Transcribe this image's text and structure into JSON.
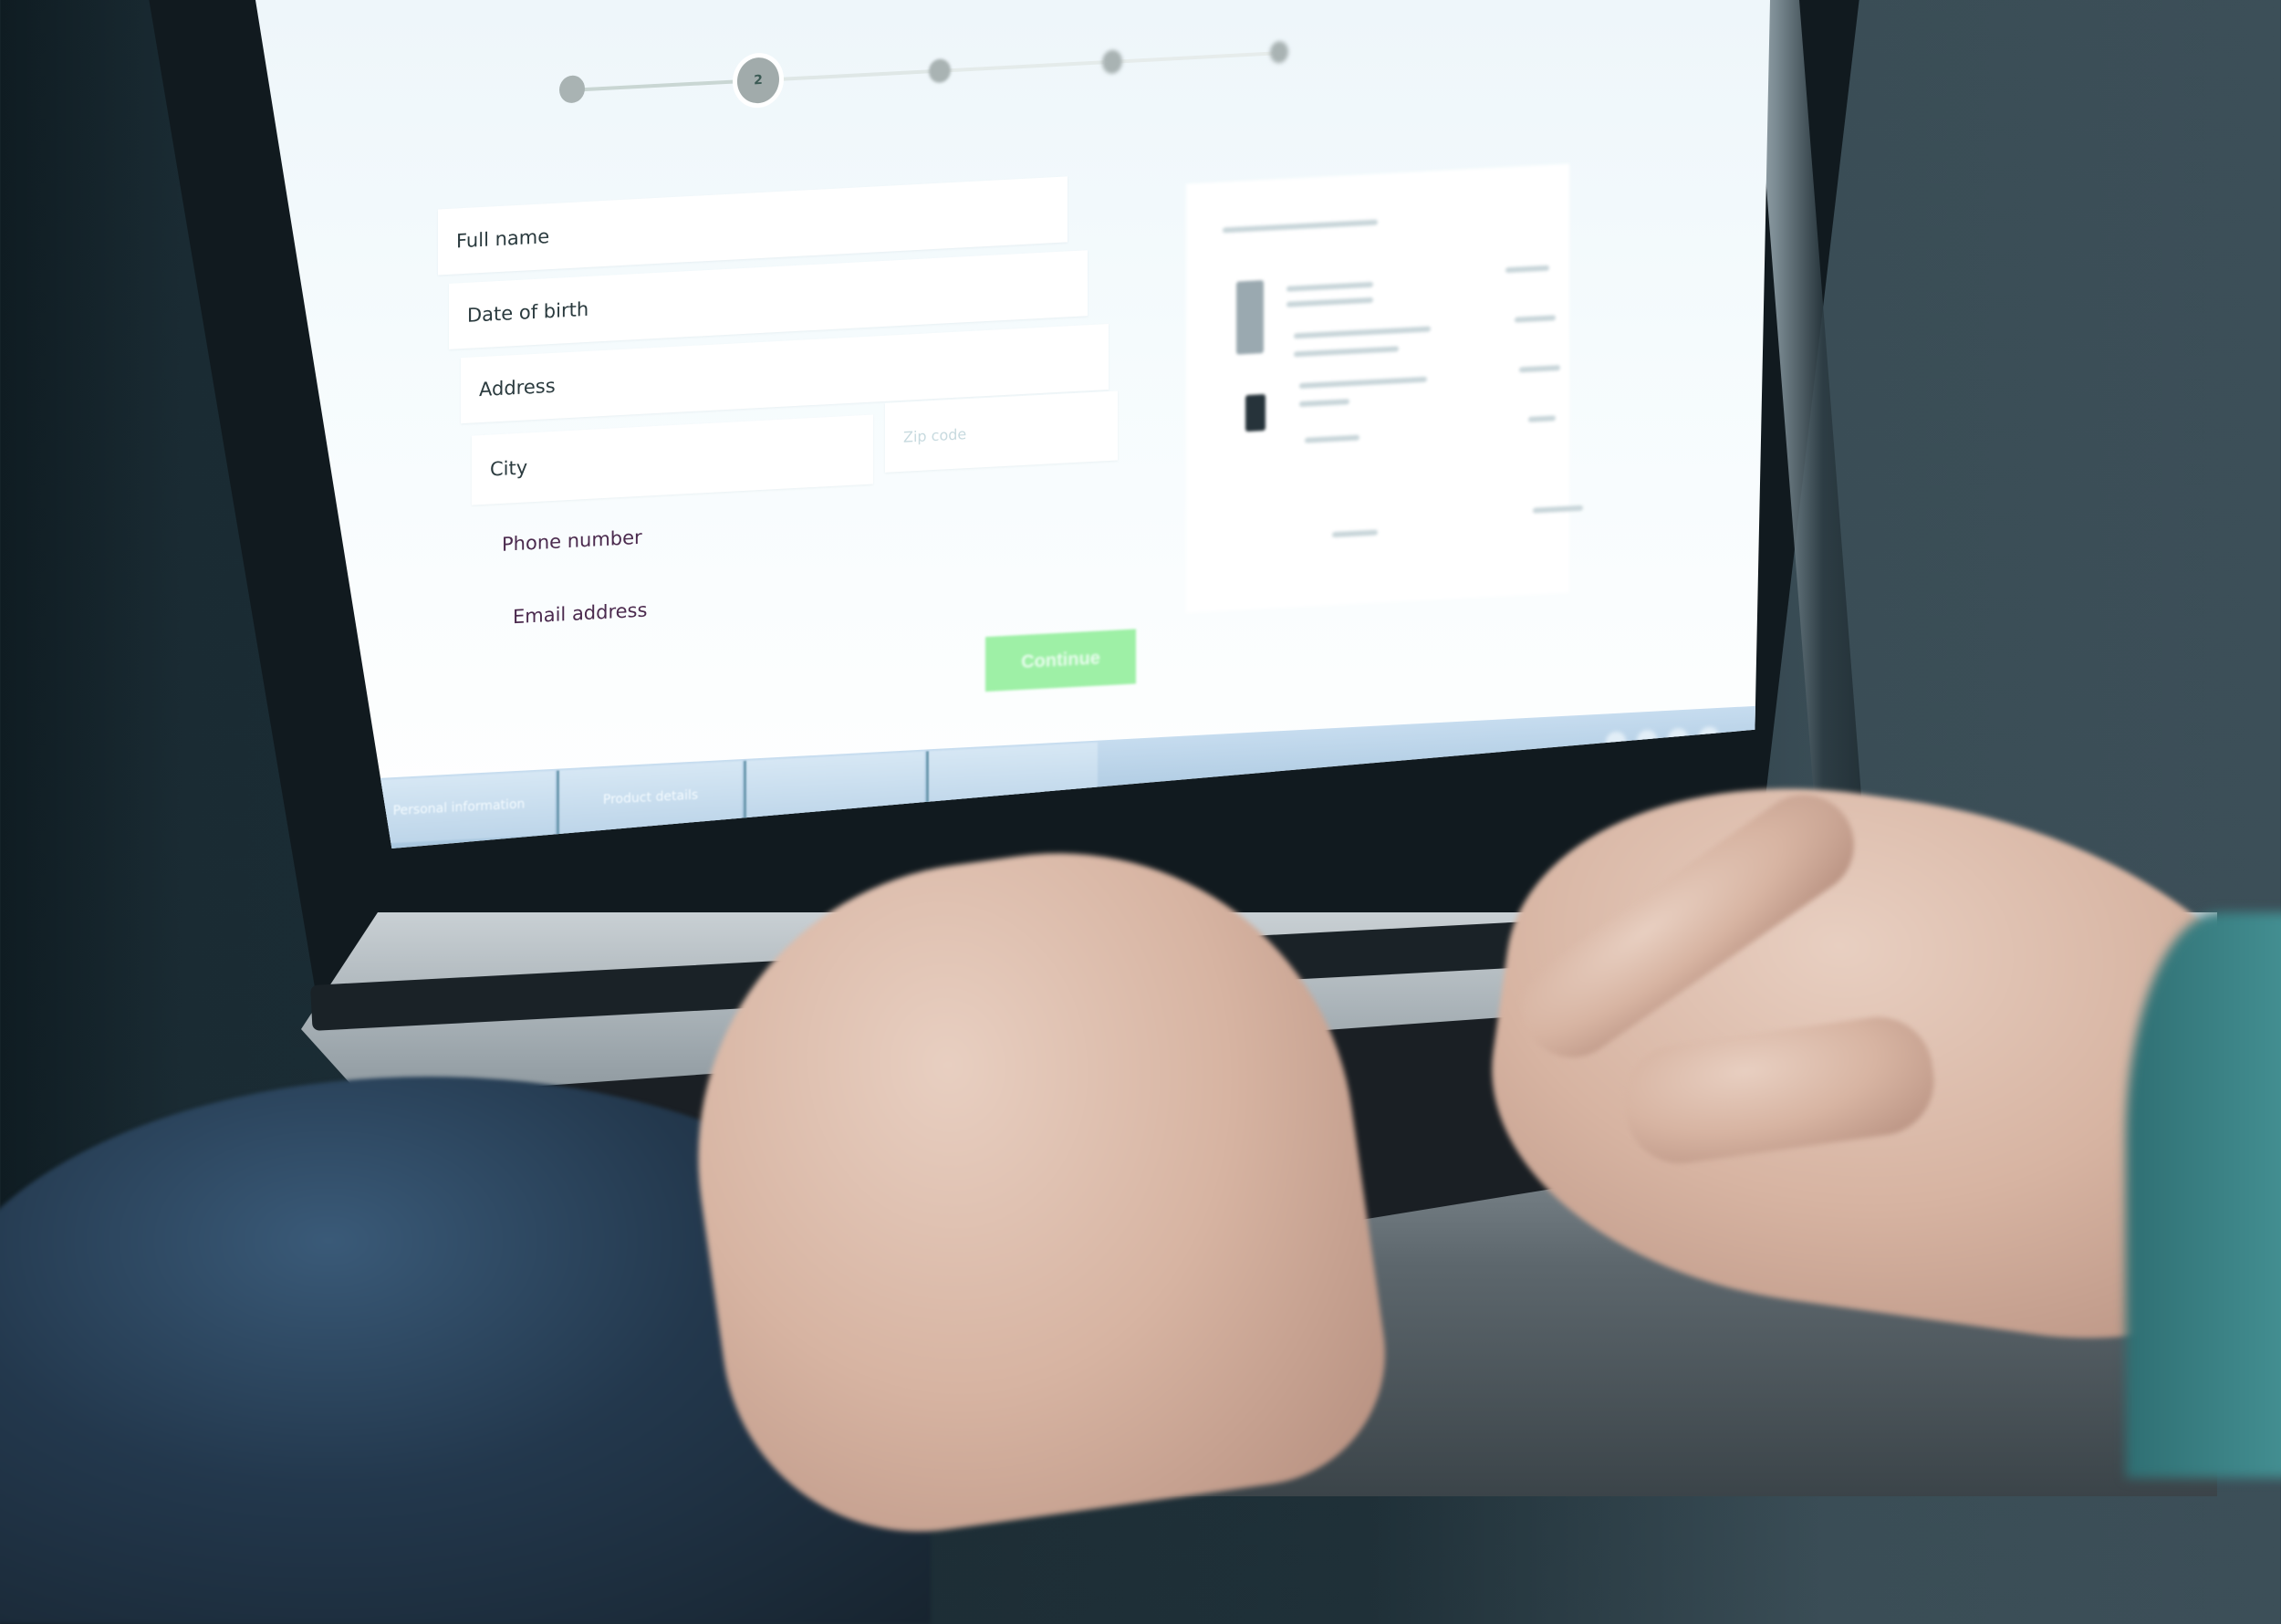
{
  "scene": {
    "description": "Person typing on a laptop displaying an online checkout/registration form",
    "colors": {
      "background": "#1f3038",
      "screen": "#f5fbfd",
      "continue_button": "#9ef0a6",
      "taskbar": "#bdd5e9",
      "stepper_dot": "#a9b3b3"
    }
  },
  "stepper": {
    "total_steps": 5,
    "active_step": 2,
    "steps": [
      {
        "label": ""
      },
      {
        "label": "2"
      },
      {
        "label": ""
      },
      {
        "label": ""
      },
      {
        "label": ""
      }
    ]
  },
  "form": {
    "fields": [
      {
        "label": "Full name"
      },
      {
        "label": "Date of birth"
      },
      {
        "label": "Address"
      },
      {
        "label": "City"
      },
      {
        "label": "Zip code"
      },
      {
        "label": "Phone number"
      },
      {
        "label": "Email address"
      }
    ],
    "continue_label": "Continue"
  },
  "summary_card": {
    "title": "",
    "items_count": 4,
    "note": "Contents illegible (out of focus)"
  },
  "taskbar": {
    "home_icon": "home-icon",
    "tabs": [
      {
        "label": "Personal information"
      },
      {
        "label": "Product details"
      },
      {
        "label": ""
      },
      {
        "label": ""
      }
    ]
  }
}
